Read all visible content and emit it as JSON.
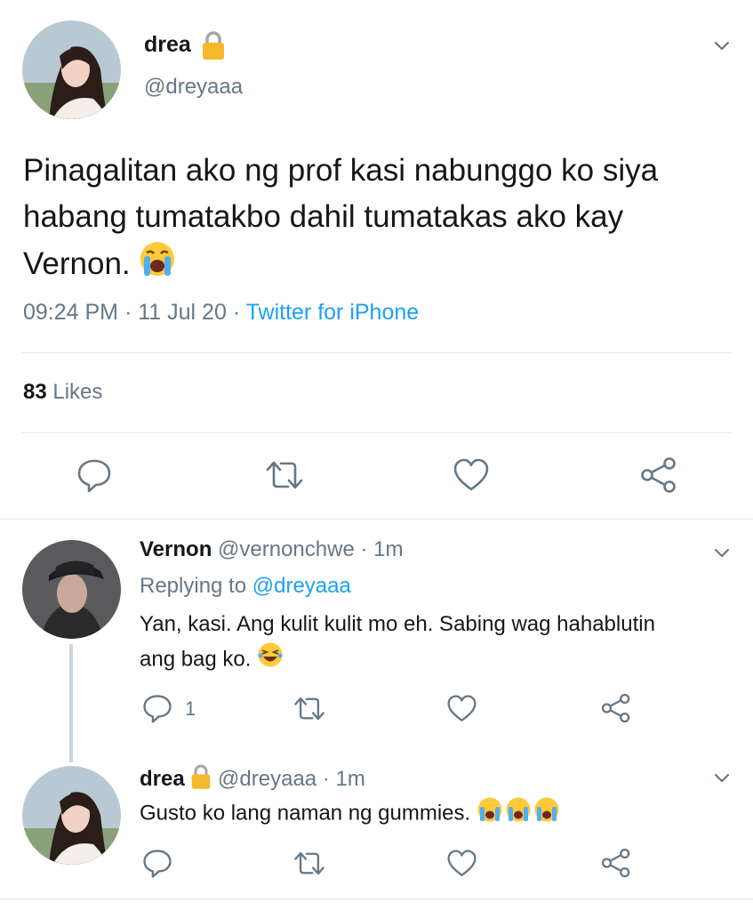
{
  "main_tweet": {
    "author_name": "drea",
    "author_lock": "🔒",
    "author_handle": "@dreyaaa",
    "text": "Pinagalitan ako ng prof kasi nabunggo ko siya habang tumatakbo dahil tumatakas ako kay Vernon.",
    "time": "09:24 PM",
    "sep1": "·",
    "date": "11 Jul 20",
    "sep2": "·",
    "source": "Twitter for iPhone",
    "likes_count": "83",
    "likes_label": "Likes"
  },
  "replies": [
    {
      "author_name": "Vernon",
      "author_handle": "@vernonchwe",
      "sep": "·",
      "age": "1m",
      "replying_label": "Replying to",
      "replying_handle": "@dreyaaa",
      "text_line1": "Yan, kasi. Ang kulit kulit mo eh. Sabing wag hahablutin",
      "text_line2": "ang bag ko.",
      "reply_count": "1"
    },
    {
      "author_name": "drea",
      "author_lock": "🔒",
      "author_handle": "@dreyaaa",
      "sep": "·",
      "age": "1m",
      "text": "Gusto ko lang naman ng gummies."
    }
  ],
  "colors": {
    "text": "#14171a",
    "muted": "#657786",
    "link": "#1da1f2",
    "divider": "#e1e8ed"
  },
  "icons": [
    "chevron-down-icon",
    "reply-icon",
    "retweet-icon",
    "like-icon",
    "share-icon",
    "lock-icon",
    "crying-emoji",
    "laughing-emoji"
  ]
}
